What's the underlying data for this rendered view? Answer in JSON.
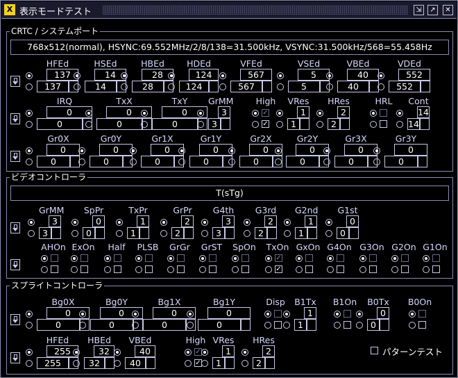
{
  "window": {
    "title": "表示モードテスト",
    "icons": [
      "app-icon",
      "restore-icon",
      "maximize-icon",
      "close-icon"
    ]
  },
  "crtc": {
    "title": "CRTC / システムポート",
    "status": "768x512(normal), HSYNC:69.552MHz/2/8/138=31.500kHz, VSYNC:31.500kHz/568=55.458Hz",
    "row1": [
      {
        "label": "HFEd",
        "v1": "137",
        "v2": "137"
      },
      {
        "label": "HSEd",
        "v1": "14",
        "v2": "14"
      },
      {
        "label": "HBEd",
        "v1": "28",
        "v2": "28"
      },
      {
        "label": "HDEd",
        "v1": "124",
        "v2": "124"
      },
      {
        "label": "VFEd",
        "v1": "567",
        "v2": "567"
      },
      {
        "label": "VSEd",
        "v1": "5",
        "v2": "5"
      },
      {
        "label": "VBEd",
        "v1": "40",
        "v2": "40"
      },
      {
        "label": "VDEd",
        "v1": "552",
        "v2": "552"
      }
    ],
    "row2": [
      {
        "label": "IRQ",
        "v1": "0",
        "v2": "0"
      },
      {
        "label": "TxX",
        "v1": "0",
        "v2": "0"
      },
      {
        "label": "TxY",
        "v1": "0",
        "v2": "0"
      },
      {
        "label": "GrMM",
        "v1": "3",
        "v2": "3"
      },
      {
        "label": "High"
      },
      {
        "label": "VRes",
        "v1": "1",
        "v2": "1"
      },
      {
        "label": "HRes",
        "v1": "2",
        "v2": "2"
      },
      {
        "label": "HRL"
      },
      {
        "label": "Cont",
        "v1": "14",
        "v2": "14"
      }
    ],
    "row3": [
      {
        "label": "Gr0X",
        "v1": "0",
        "v2": "0"
      },
      {
        "label": "Gr0Y",
        "v1": "0",
        "v2": "0"
      },
      {
        "label": "Gr1X",
        "v1": "0",
        "v2": "0"
      },
      {
        "label": "Gr1Y",
        "v1": "0",
        "v2": "0"
      },
      {
        "label": "Gr2X",
        "v1": "0",
        "v2": "0"
      },
      {
        "label": "Gr2Y",
        "v1": "0",
        "v2": "0"
      },
      {
        "label": "Gr3X",
        "v1": "0",
        "v2": "0"
      },
      {
        "label": "Gr3Y",
        "v1": "0",
        "v2": "0"
      }
    ]
  },
  "video": {
    "title": "ビデオコントローラ",
    "status": "T(sTg)",
    "row1": [
      {
        "label": "GrMM",
        "v1": "3",
        "v2": "3"
      },
      {
        "label": "SpPr",
        "v1": "0",
        "v2": "0"
      },
      {
        "label": "TxPr",
        "v1": "1",
        "v2": "1"
      },
      {
        "label": "GrPr",
        "v1": "2",
        "v2": "2"
      },
      {
        "label": "G4th",
        "v1": "3",
        "v2": "3"
      },
      {
        "label": "G3rd",
        "v1": "2",
        "v2": "2"
      },
      {
        "label": "G2nd",
        "v1": "1",
        "v2": "1"
      },
      {
        "label": "G1st",
        "v1": "0",
        "v2": "0"
      }
    ],
    "row2": [
      "AHOn",
      "ExOn",
      "Half",
      "PLSB",
      "GrGr",
      "GrST",
      "SpOn",
      "TxOn",
      "GxOn",
      "G4On",
      "G3On",
      "G2On",
      "G1On"
    ]
  },
  "sprite": {
    "title": "スプライトコントローラ",
    "row1": [
      {
        "label": "Bg0X",
        "v1": "0",
        "v2": "0"
      },
      {
        "label": "Bg0Y",
        "v1": "0",
        "v2": "0"
      },
      {
        "label": "Bg1X",
        "v1": "0",
        "v2": "0"
      },
      {
        "label": "Bg1Y",
        "v1": "0",
        "v2": "0"
      },
      {
        "label": "Disp"
      },
      {
        "label": "B1Tx",
        "v1": "1",
        "v2": "1"
      },
      {
        "label": "B1On"
      },
      {
        "label": "B0Tx",
        "v1": "0",
        "v2": "0"
      },
      {
        "label": "B0On"
      }
    ],
    "row2": [
      {
        "label": "HFEd",
        "v1": "255",
        "v2": "255"
      },
      {
        "label": "HBEd",
        "v1": "32",
        "v2": "32"
      },
      {
        "label": "VBEd",
        "v1": "40",
        "v2": "40"
      },
      {
        "label": "High"
      },
      {
        "label": "VRes",
        "v1": "1",
        "v2": "1"
      },
      {
        "label": "HRes",
        "v1": "2",
        "v2": "2"
      }
    ],
    "pattern_test": "パターンテスト"
  },
  "check_mark": "✓"
}
